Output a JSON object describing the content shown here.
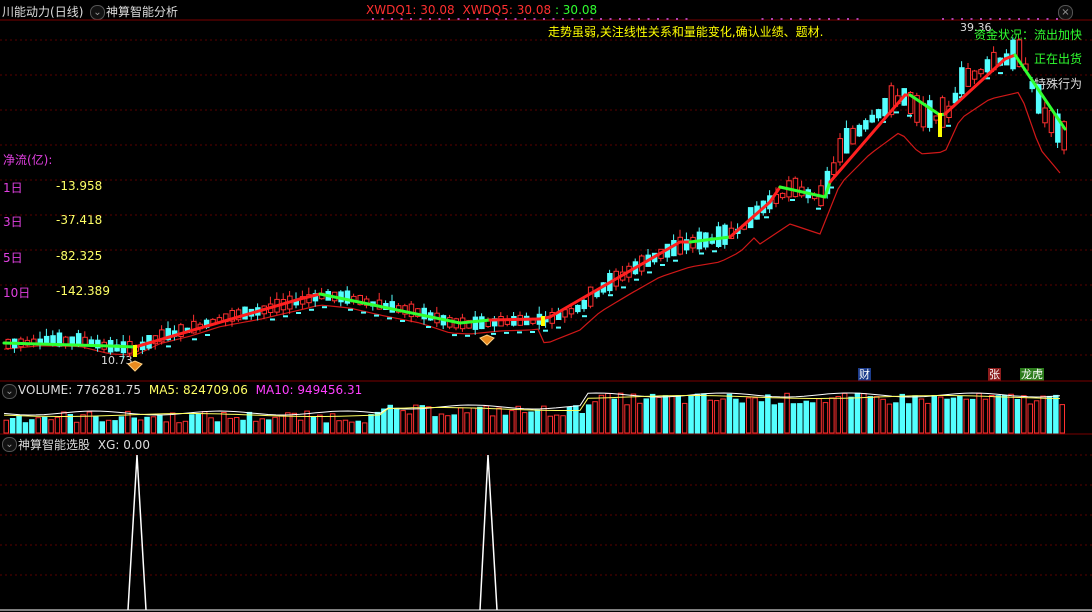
{
  "header": {
    "stock_name": "川能动力",
    "period": "(日线)",
    "indicator_name": "神算智能分析",
    "xwdq1_label": "XWDQ1:",
    "xwdq1_value": "30.08",
    "xwdq5_label": "XWDQ5:",
    "xwdq5_value": "30.08",
    "extra_value": ": 30.08"
  },
  "main": {
    "commentary": "走势虽弱,关注线性关系和量能变化,确认业绩、题材.",
    "high_price_label": "39.36",
    "low_price_label": "10.73",
    "fund_status": "资金状况：流出加快",
    "shipping_status": "正在出货",
    "special_behavior": "特殊行为",
    "tags": {
      "cai": "财",
      "zhang": "张",
      "longhu": "龙虎"
    }
  },
  "net_flow": {
    "title": "净流(亿):",
    "rows": [
      {
        "label": "1日",
        "value": "-13.958"
      },
      {
        "label": "3日",
        "value": "-37.418"
      },
      {
        "label": "5日",
        "value": "-82.325"
      },
      {
        "label": "10日",
        "value": "-142.389"
      }
    ]
  },
  "volume_panel": {
    "label": "VOLUME:",
    "value": "776281.75",
    "ma5_label": "MA5:",
    "ma5_value": "824709.06",
    "ma10_label": "MA10:",
    "ma10_value": "949456.31"
  },
  "xg_panel": {
    "label": "神算智能选股",
    "xg_label": "XG:",
    "xg_value": "0.00"
  },
  "colors": {
    "up": "#ff3030",
    "down": "#54ffff",
    "green_line": "#30ff30",
    "red_line": "#ff2020",
    "ma_line": "#d01818",
    "volume_up": "#ff3030",
    "volume_down": "#54ffff",
    "magenta": "#e040e0",
    "yellow": "#ffff66"
  },
  "chart_data": {
    "type": "candlestick",
    "signal_peaks": [
      1,
      1
    ]
  }
}
